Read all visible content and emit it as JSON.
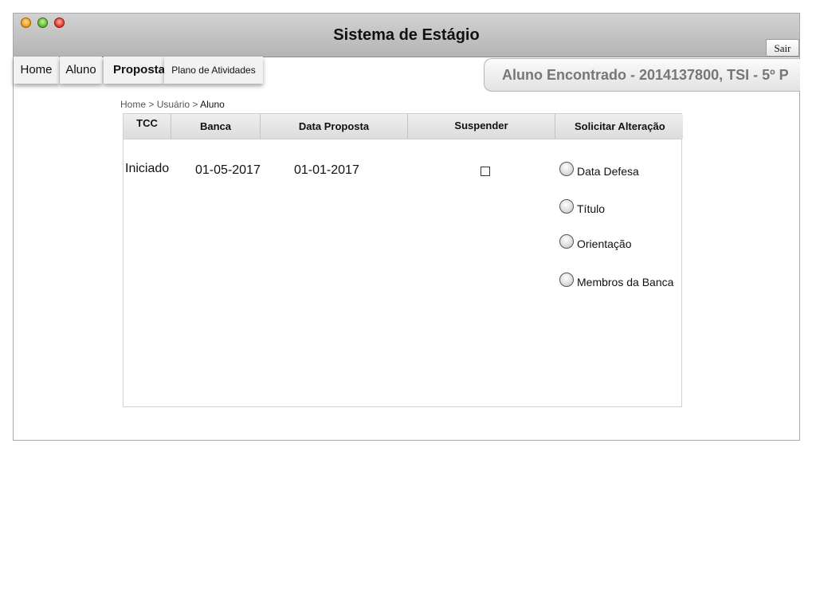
{
  "window": {
    "title": "Sistema de Estágio",
    "logout_label": "Sair"
  },
  "nav": {
    "tabs": [
      {
        "label": "Home"
      },
      {
        "label": "Aluno"
      },
      {
        "label": "Proposta"
      },
      {
        "label": "Plano de Atividades"
      }
    ]
  },
  "status_text": "Aluno Encontrado - 2014137800, TSI - 5º P",
  "breadcrumb": {
    "items": [
      "Home",
      "Usuário",
      "Aluno"
    ],
    "separator": ">"
  },
  "table": {
    "columns": [
      "TCC",
      "Banca",
      "Data Proposta",
      "Suspender",
      "Solicitar Alteração"
    ],
    "row": {
      "tcc": "Iniciado",
      "banca": "01-05-2017",
      "data_proposta": "01-01-2017",
      "suspender_checked": false
    }
  },
  "alteration_options": [
    {
      "label": "Data Defesa",
      "selected": false
    },
    {
      "label": "Título",
      "selected": false
    },
    {
      "label": "Orientação",
      "selected": false
    },
    {
      "label": "Membros da Banca",
      "selected": false
    }
  ],
  "colors": {
    "titlebar": "#c4c4c4",
    "status_text": "#777777",
    "header_bg": "#e1e1e1"
  }
}
